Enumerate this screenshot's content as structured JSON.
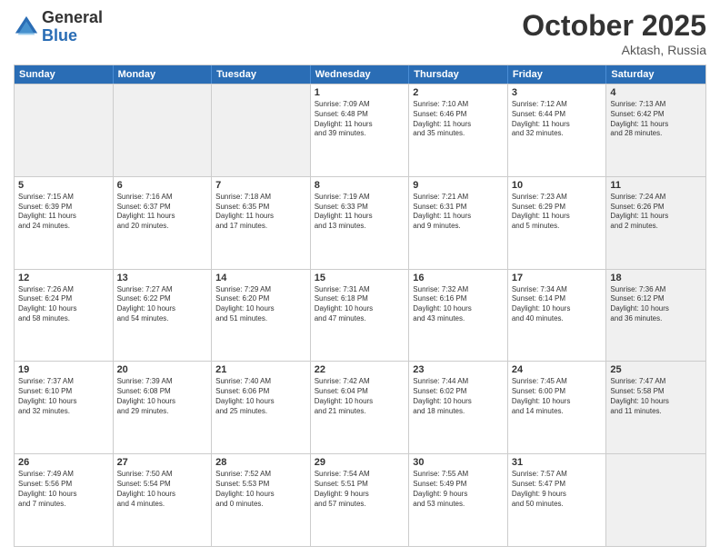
{
  "header": {
    "logo_general": "General",
    "logo_blue": "Blue",
    "month": "October 2025",
    "location": "Aktash, Russia"
  },
  "days_of_week": [
    "Sunday",
    "Monday",
    "Tuesday",
    "Wednesday",
    "Thursday",
    "Friday",
    "Saturday"
  ],
  "weeks": [
    [
      {
        "day": "",
        "info": "",
        "shaded": true
      },
      {
        "day": "",
        "info": "",
        "shaded": true
      },
      {
        "day": "",
        "info": "",
        "shaded": true
      },
      {
        "day": "1",
        "info": "Sunrise: 7:09 AM\nSunset: 6:48 PM\nDaylight: 11 hours\nand 39 minutes."
      },
      {
        "day": "2",
        "info": "Sunrise: 7:10 AM\nSunset: 6:46 PM\nDaylight: 11 hours\nand 35 minutes."
      },
      {
        "day": "3",
        "info": "Sunrise: 7:12 AM\nSunset: 6:44 PM\nDaylight: 11 hours\nand 32 minutes."
      },
      {
        "day": "4",
        "info": "Sunrise: 7:13 AM\nSunset: 6:42 PM\nDaylight: 11 hours\nand 28 minutes.",
        "shaded": true
      }
    ],
    [
      {
        "day": "5",
        "info": "Sunrise: 7:15 AM\nSunset: 6:39 PM\nDaylight: 11 hours\nand 24 minutes."
      },
      {
        "day": "6",
        "info": "Sunrise: 7:16 AM\nSunset: 6:37 PM\nDaylight: 11 hours\nand 20 minutes."
      },
      {
        "day": "7",
        "info": "Sunrise: 7:18 AM\nSunset: 6:35 PM\nDaylight: 11 hours\nand 17 minutes."
      },
      {
        "day": "8",
        "info": "Sunrise: 7:19 AM\nSunset: 6:33 PM\nDaylight: 11 hours\nand 13 minutes."
      },
      {
        "day": "9",
        "info": "Sunrise: 7:21 AM\nSunset: 6:31 PM\nDaylight: 11 hours\nand 9 minutes."
      },
      {
        "day": "10",
        "info": "Sunrise: 7:23 AM\nSunset: 6:29 PM\nDaylight: 11 hours\nand 5 minutes."
      },
      {
        "day": "11",
        "info": "Sunrise: 7:24 AM\nSunset: 6:26 PM\nDaylight: 11 hours\nand 2 minutes.",
        "shaded": true
      }
    ],
    [
      {
        "day": "12",
        "info": "Sunrise: 7:26 AM\nSunset: 6:24 PM\nDaylight: 10 hours\nand 58 minutes."
      },
      {
        "day": "13",
        "info": "Sunrise: 7:27 AM\nSunset: 6:22 PM\nDaylight: 10 hours\nand 54 minutes."
      },
      {
        "day": "14",
        "info": "Sunrise: 7:29 AM\nSunset: 6:20 PM\nDaylight: 10 hours\nand 51 minutes."
      },
      {
        "day": "15",
        "info": "Sunrise: 7:31 AM\nSunset: 6:18 PM\nDaylight: 10 hours\nand 47 minutes."
      },
      {
        "day": "16",
        "info": "Sunrise: 7:32 AM\nSunset: 6:16 PM\nDaylight: 10 hours\nand 43 minutes."
      },
      {
        "day": "17",
        "info": "Sunrise: 7:34 AM\nSunset: 6:14 PM\nDaylight: 10 hours\nand 40 minutes."
      },
      {
        "day": "18",
        "info": "Sunrise: 7:36 AM\nSunset: 6:12 PM\nDaylight: 10 hours\nand 36 minutes.",
        "shaded": true
      }
    ],
    [
      {
        "day": "19",
        "info": "Sunrise: 7:37 AM\nSunset: 6:10 PM\nDaylight: 10 hours\nand 32 minutes."
      },
      {
        "day": "20",
        "info": "Sunrise: 7:39 AM\nSunset: 6:08 PM\nDaylight: 10 hours\nand 29 minutes."
      },
      {
        "day": "21",
        "info": "Sunrise: 7:40 AM\nSunset: 6:06 PM\nDaylight: 10 hours\nand 25 minutes."
      },
      {
        "day": "22",
        "info": "Sunrise: 7:42 AM\nSunset: 6:04 PM\nDaylight: 10 hours\nand 21 minutes."
      },
      {
        "day": "23",
        "info": "Sunrise: 7:44 AM\nSunset: 6:02 PM\nDaylight: 10 hours\nand 18 minutes."
      },
      {
        "day": "24",
        "info": "Sunrise: 7:45 AM\nSunset: 6:00 PM\nDaylight: 10 hours\nand 14 minutes."
      },
      {
        "day": "25",
        "info": "Sunrise: 7:47 AM\nSunset: 5:58 PM\nDaylight: 10 hours\nand 11 minutes.",
        "shaded": true
      }
    ],
    [
      {
        "day": "26",
        "info": "Sunrise: 7:49 AM\nSunset: 5:56 PM\nDaylight: 10 hours\nand 7 minutes."
      },
      {
        "day": "27",
        "info": "Sunrise: 7:50 AM\nSunset: 5:54 PM\nDaylight: 10 hours\nand 4 minutes."
      },
      {
        "day": "28",
        "info": "Sunrise: 7:52 AM\nSunset: 5:53 PM\nDaylight: 10 hours\nand 0 minutes."
      },
      {
        "day": "29",
        "info": "Sunrise: 7:54 AM\nSunset: 5:51 PM\nDaylight: 9 hours\nand 57 minutes."
      },
      {
        "day": "30",
        "info": "Sunrise: 7:55 AM\nSunset: 5:49 PM\nDaylight: 9 hours\nand 53 minutes."
      },
      {
        "day": "31",
        "info": "Sunrise: 7:57 AM\nSunset: 5:47 PM\nDaylight: 9 hours\nand 50 minutes."
      },
      {
        "day": "",
        "info": "",
        "shaded": true
      }
    ]
  ]
}
